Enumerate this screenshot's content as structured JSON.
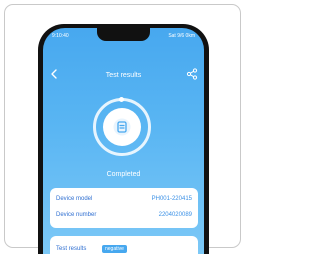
{
  "status_bar": {
    "time": "9:10:40",
    "right": "Sat 9/6 0km"
  },
  "nav": {
    "title": "Test results",
    "back_icon": "chevron-left-icon",
    "share_icon": "share-icon"
  },
  "result": {
    "status": "Completed",
    "icon": "document-icon"
  },
  "device": {
    "model_label": "Device model",
    "model_value": "PH001-220415",
    "number_label": "Device number",
    "number_value": "2204020089"
  },
  "test": {
    "label": "Test results",
    "badge": "negative"
  },
  "colors": {
    "accent": "#47a8ef",
    "label": "#2f6fd1"
  }
}
